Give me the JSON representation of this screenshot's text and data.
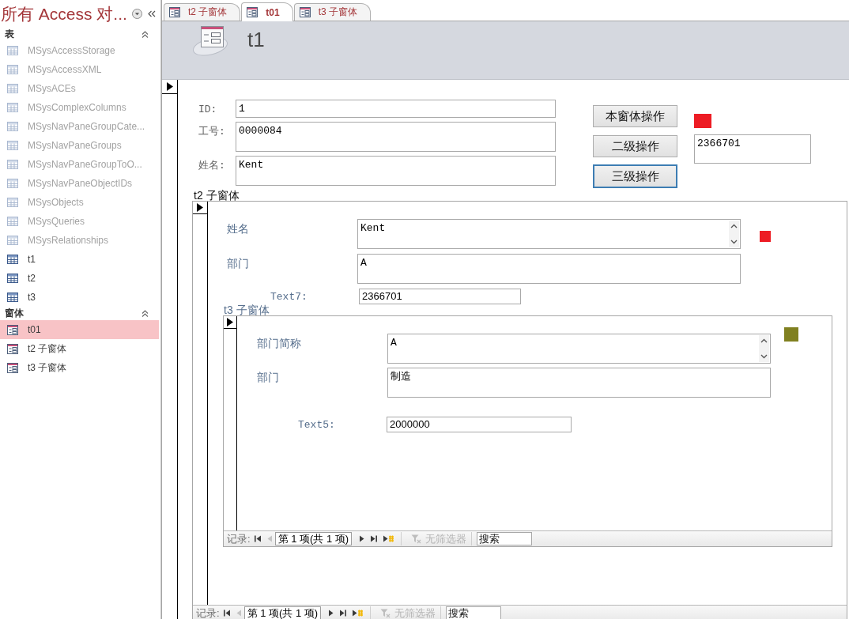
{
  "nav_pane": {
    "title": "所有 Access 对...",
    "groups": [
      {
        "label": "表",
        "kind": "table",
        "expanded": true,
        "items": [
          {
            "label": "MSysAccessStorage",
            "dimmed": true,
            "selected": false
          },
          {
            "label": "MSysAccessXML",
            "dimmed": true,
            "selected": false
          },
          {
            "label": "MSysACEs",
            "dimmed": true,
            "selected": false
          },
          {
            "label": "MSysComplexColumns",
            "dimmed": true,
            "selected": false
          },
          {
            "label": "MSysNavPaneGroupCate...",
            "dimmed": true,
            "selected": false
          },
          {
            "label": "MSysNavPaneGroups",
            "dimmed": true,
            "selected": false
          },
          {
            "label": "MSysNavPaneGroupToO...",
            "dimmed": true,
            "selected": false
          },
          {
            "label": "MSysNavPaneObjectIDs",
            "dimmed": true,
            "selected": false
          },
          {
            "label": "MSysObjects",
            "dimmed": true,
            "selected": false
          },
          {
            "label": "MSysQueries",
            "dimmed": true,
            "selected": false
          },
          {
            "label": "MSysRelationships",
            "dimmed": true,
            "selected": false
          },
          {
            "label": "t1",
            "dimmed": false,
            "selected": false
          },
          {
            "label": "t2",
            "dimmed": false,
            "selected": false
          },
          {
            "label": "t3",
            "dimmed": false,
            "selected": false
          }
        ]
      },
      {
        "label": "窗体",
        "kind": "form",
        "expanded": true,
        "items": [
          {
            "label": "t01",
            "dimmed": false,
            "selected": true
          },
          {
            "label": "t2 子窗体",
            "dimmed": false,
            "selected": false
          },
          {
            "label": "t3 子窗体",
            "dimmed": false,
            "selected": false
          }
        ]
      }
    ]
  },
  "document_tabs": [
    {
      "label": "t2 子窗体",
      "selected": false
    },
    {
      "label": "t01",
      "selected": true
    },
    {
      "label": "t3 子窗体",
      "selected": false
    }
  ],
  "form": {
    "title": "t1",
    "fields": [
      {
        "label": "ID:",
        "value": "1",
        "kind": "single"
      },
      {
        "label": "工号:",
        "value": "0000084",
        "kind": "multi"
      },
      {
        "label": "姓名:",
        "value": "Kent",
        "kind": "multi"
      }
    ],
    "buttons": [
      {
        "label": "本窗体操作",
        "focused": false
      },
      {
        "label": "二级操作",
        "focused": false
      },
      {
        "label": "三级操作",
        "focused": true
      }
    ],
    "swatch": {
      "color": "#ed1c24"
    },
    "side_field": {
      "value": "2366701"
    },
    "subform": {
      "label": "t2 子窗体",
      "fields": [
        {
          "label": "姓名",
          "value": "Kent",
          "kind": "scroll"
        },
        {
          "label": "部门",
          "value": "A",
          "kind": "multi"
        },
        {
          "label": "Text7:",
          "value": "2366701",
          "kind": "single"
        }
      ],
      "swatch": {
        "color": "#ed1c24"
      },
      "subform": {
        "label": "t3 子窗体",
        "fields": [
          {
            "label": "部门简称",
            "value": "A",
            "kind": "scroll"
          },
          {
            "label": "部门",
            "value": "制造",
            "kind": "multi"
          },
          {
            "label": "Text5:",
            "value": "2000000",
            "kind": "single"
          }
        ],
        "swatch": {
          "color": "#808020"
        },
        "navigation": {
          "label": "记录:",
          "back_buttons": [
            {
              "kind": "first",
              "disabled": false
            },
            {
              "kind": "previous",
              "disabled": true
            }
          ],
          "position": "第 1 项(共 1 项)",
          "forward_buttons": [
            {
              "kind": "next",
              "disabled": false
            },
            {
              "kind": "last",
              "disabled": false
            },
            {
              "kind": "new",
              "disabled": false
            }
          ],
          "filter": {
            "label": "无筛选器",
            "disabled": true
          },
          "search": {
            "placeholder": "搜索"
          }
        }
      },
      "navigation": {
        "label": "记录:",
        "back_buttons": [
          {
            "kind": "first",
            "disabled": false
          },
          {
            "kind": "previous",
            "disabled": true
          }
        ],
        "position": "第 1 项(共 1 项)",
        "forward_buttons": [
          {
            "kind": "next",
            "disabled": false
          },
          {
            "kind": "last",
            "disabled": false
          },
          {
            "kind": "new",
            "disabled": false
          }
        ],
        "filter": {
          "label": "无筛选器",
          "disabled": true
        },
        "search": {
          "placeholder": "搜索"
        }
      }
    }
  }
}
